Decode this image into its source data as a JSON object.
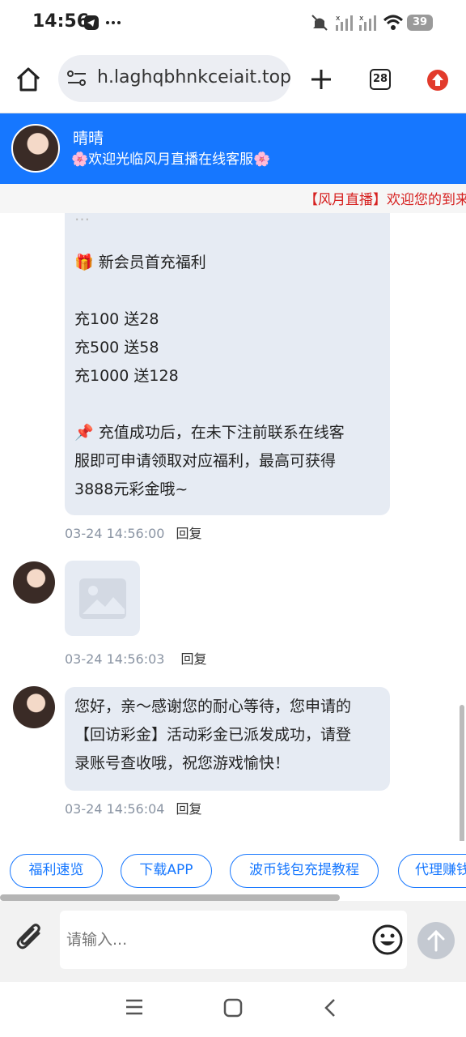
{
  "status_bar": {
    "time": "14:56",
    "battery": "39"
  },
  "browser": {
    "url": "h.laghqbhnkceiait.top",
    "tab_count": "28"
  },
  "chat_header": {
    "agent_name": "晴晴",
    "subtitle": "🌸欢迎光临风月直播在线客服🌸"
  },
  "marquee": {
    "text": "【风月直播】欢迎您的到来"
  },
  "messages": [
    {
      "partial_top": "…",
      "gift_line": "🎁 新会员首充福利",
      "rows": [
        "充100 送28",
        "充500 送58",
        "充1000 送128"
      ],
      "note_line1": "📌 充值成功后，在未下注前联系在线客",
      "note_line2": "服即可申请领取对应福利，最高可获得",
      "note_line3": "3888元彩金哦~",
      "time": "03-24 14:56:00",
      "reply": "回复"
    },
    {
      "image_alt": "image-placeholder",
      "time": "03-24 14:56:03",
      "reply": "回复"
    },
    {
      "line1": "您好，亲～感谢您的耐心等待，您申请的",
      "line2": "【回访彩金】活动彩金已派发成功，请登",
      "line3": "录账号查收哦，祝您游戏愉快！",
      "time": "03-24 14:56:04",
      "reply": "回复"
    }
  ],
  "quick_buttons": [
    "福利速览",
    "下载APP",
    "波币钱包充提教程",
    "代理赚钱"
  ],
  "input": {
    "placeholder": "请输入..."
  },
  "colors": {
    "accent": "#1677ff",
    "marquee_text": "#d6201f",
    "bubble": "#e6ebf3"
  },
  "icons": [
    "home-icon",
    "site-settings-icon",
    "plus-icon",
    "upload-icon",
    "attach-icon",
    "emoji-icon",
    "send-icon",
    "menu-icon",
    "home-square-icon",
    "back-icon"
  ]
}
